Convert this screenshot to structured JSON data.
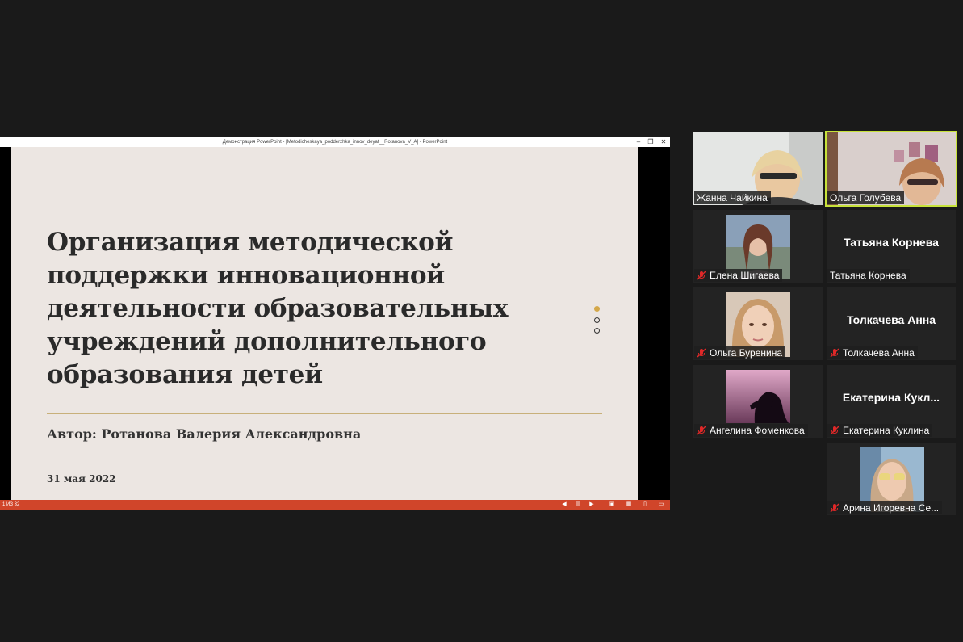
{
  "ppt": {
    "window_title": "Демонстрация PowerPoint - [Metodicheskaya_podderzhka_innov_deyat__Rotanova_V_A] - PowerPoint",
    "slide_title_lines": [
      "Организация методической",
      "поддержки инновационной",
      "деятельности образовательных",
      "учреждений дополнительного",
      "образования детей"
    ],
    "author": "Автор: Ротанова Валерия Александровна",
    "date": "31 мая 2022",
    "slide_counter": "1 ИЗ 32",
    "accent_color": "#d4a84a",
    "status_bar_color": "#d0452a"
  },
  "participants": [
    {
      "name": "Жанна Чайкина",
      "video": true,
      "muted": false
    },
    {
      "name": "Ольга  Голубева",
      "video": true,
      "muted": false,
      "active_speaker": true
    },
    {
      "name": "Елена Шигаева",
      "video": true,
      "muted": true
    },
    {
      "name": "Татьяна Корнева",
      "display_name": "Татьяна Корнева",
      "video": false,
      "muted": false
    },
    {
      "name": "Ольга Буренина",
      "video": true,
      "muted": true
    },
    {
      "name": "Толкачева Анна",
      "display_name": "Толкачева Анна",
      "video": false,
      "muted": true
    },
    {
      "name": "Ангелина Фоменкова",
      "video": true,
      "muted": true
    },
    {
      "name": "Екатерина Куклина",
      "display_name": "Екатерина  Кукл...",
      "video": false,
      "muted": true
    },
    {
      "name": "Арина Игоревна Се...",
      "video": true,
      "muted": true
    }
  ],
  "colors": {
    "active_speaker_border": "#c7e23a",
    "mute_icon": "#e02828"
  }
}
